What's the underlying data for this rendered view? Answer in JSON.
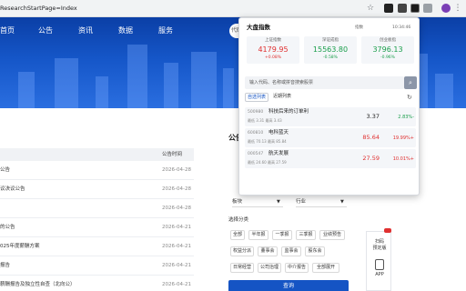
{
  "browser": {
    "url": "ResearchStartPage=Index"
  },
  "nav": {
    "items": [
      "首页",
      "公告",
      "资讯",
      "数据",
      "服务"
    ],
    "search_placeholder": "代码"
  },
  "list": {
    "header_date": "公告时间",
    "rows": [
      {
        "title": "公告",
        "date": "2026-04-28"
      },
      {
        "title": "议决议公告",
        "date": "2026-04-28"
      },
      {
        "title": "",
        "date": "2026-04-28"
      },
      {
        "title": "的公告",
        "date": "2026-04-21"
      },
      {
        "title": "025年度薪酬方案",
        "date": "2026-04-21"
      },
      {
        "title": "报告",
        "date": "2026-04-21"
      },
      {
        "title": "薪酬报告及独立性自查（北向公）",
        "date": "2026-04-21"
      },
      {
        "title": "薪酬报告及独立性自查（南向）",
        "date": "2026-04-21"
      }
    ]
  },
  "filter": {
    "title": "公告",
    "box_left": "板块",
    "box_right": "行业",
    "section": "选择分类",
    "chips": [
      "全部",
      "半年报",
      "一季报",
      "三季报",
      "业绩预告",
      "权益分派",
      "董事会",
      "监事会",
      "股东会",
      "日常经营",
      "公司治理",
      "中介报告",
      "全部展开"
    ],
    "query_label": "查询"
  },
  "side_float": {
    "label_1": "扫码",
    "label_2": "预定版",
    "label_3": "APP"
  },
  "popup": {
    "title": "大盘指数",
    "sub_left": "指数",
    "sub_time": "10:34:46",
    "indices": [
      {
        "name": "上证指数",
        "value": "4179.95",
        "change": "+0.08%",
        "color": "#e03030"
      },
      {
        "name": "深证成指",
        "value": "15563.80",
        "change": "-0.58%",
        "color": "#1a9e4b"
      },
      {
        "name": "创业板指",
        "value": "3796.13",
        "change": "-0.96%",
        "color": "#1a9e4b"
      }
    ],
    "search_placeholder": "输入代码、名称或拼音搜索股票",
    "tab_active": "自选列表",
    "tab_other": "近期列表",
    "stocks": [
      {
        "code": "500980",
        "name": "科技后来的订单利",
        "meta": "最低 3.31  最高 3.43",
        "price": "3.37",
        "pct": "-2.83%",
        "color": "#1a9e4b"
      },
      {
        "code": "600810",
        "name": "电科蓝天",
        "meta": "最低 70.13  最高 85.84",
        "price": "85.64",
        "pct": "+19.99%",
        "color": "#e03030"
      },
      {
        "code": "000547",
        "name": "航天发展",
        "meta": "最低 24.60  最高 27.59",
        "price": "27.59",
        "pct": "+10.01%",
        "color": "#e03030"
      }
    ]
  },
  "colors": {
    "brand_blue": "#1554c4",
    "up_red": "#e03030",
    "down_green": "#1a9e4b"
  }
}
